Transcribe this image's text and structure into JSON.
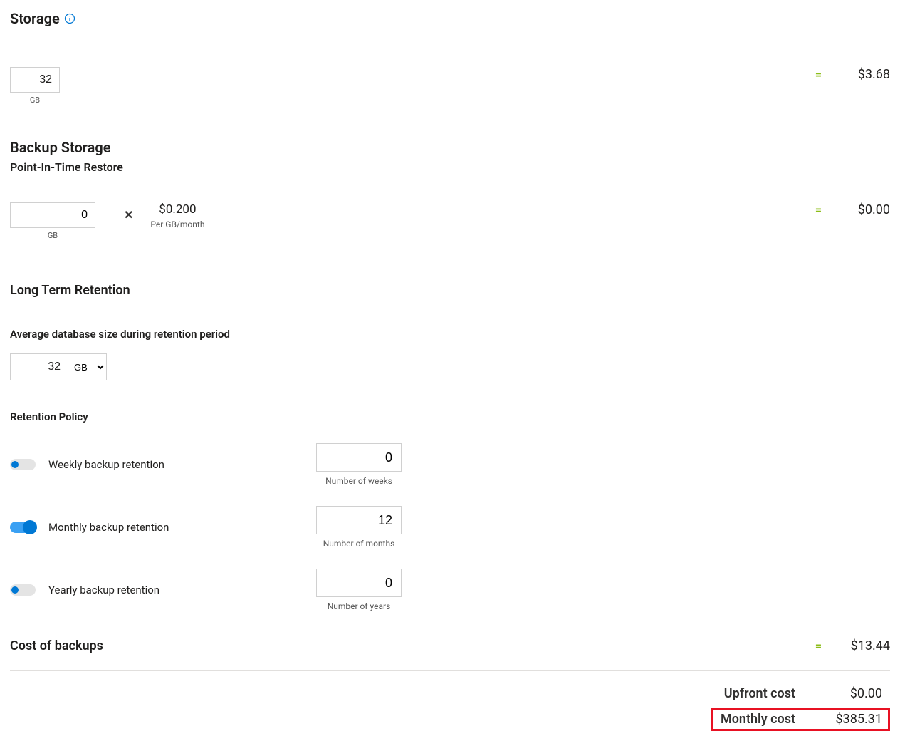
{
  "storage": {
    "title": "Storage",
    "size_value": "32",
    "size_unit": "GB",
    "cost": "$3.68"
  },
  "backup": {
    "title": "Backup Storage",
    "pitr_title": "Point-In-Time Restore",
    "pitr_value": "0",
    "pitr_unit": "GB",
    "rate_value": "$0.200",
    "rate_caption": "Per GB/month",
    "pitr_cost": "$0.00"
  },
  "ltr": {
    "title": "Long Term Retention",
    "avg_label": "Average database size during retention period",
    "avg_value": "32",
    "avg_unit": "GB",
    "policy_label": "Retention Policy",
    "weekly_label": "Weekly backup retention",
    "weekly_value": "0",
    "weekly_caption": "Number of weeks",
    "monthly_label": "Monthly backup retention",
    "monthly_value": "12",
    "monthly_caption": "Number of months",
    "yearly_label": "Yearly backup retention",
    "yearly_value": "0",
    "yearly_caption": "Number of years",
    "cost_label": "Cost of backups",
    "cost_value": "$13.44"
  },
  "summary": {
    "upfront_label": "Upfront cost",
    "upfront_value": "$0.00",
    "monthly_label": "Monthly cost",
    "monthly_value": "$385.31"
  },
  "symbols": {
    "equals": "=",
    "times": "✕"
  }
}
